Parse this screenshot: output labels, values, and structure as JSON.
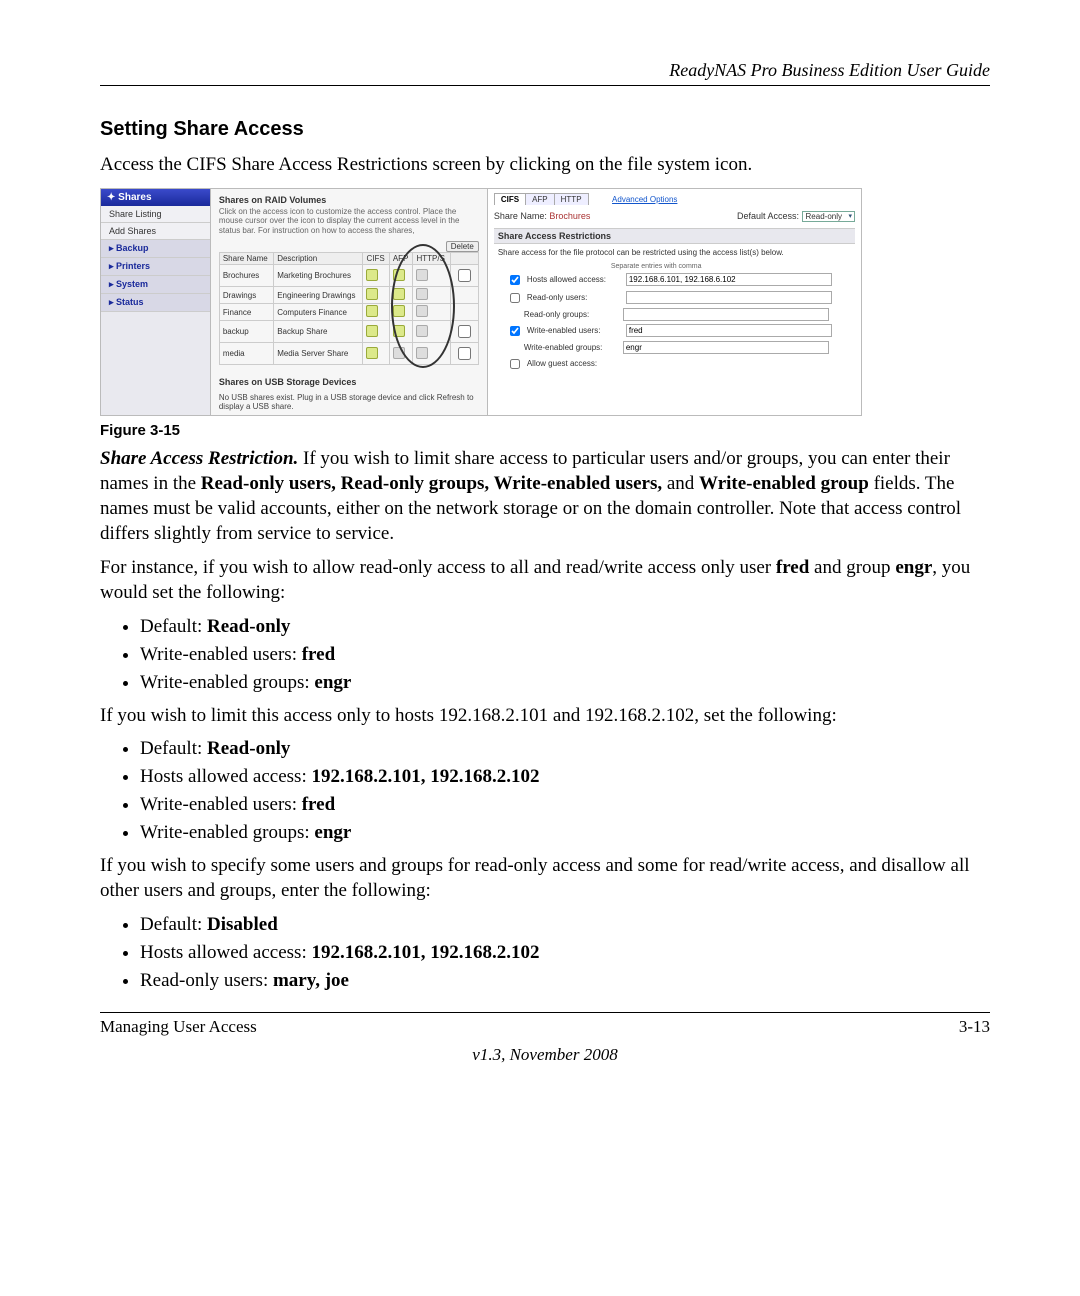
{
  "header": {
    "title": "ReadyNAS Pro Business Edition User Guide"
  },
  "section": {
    "title": "Setting Share Access"
  },
  "intro": "Access the CIFS Share Access Restrictions screen by clicking on the file system icon.",
  "figure_caption": "Figure 3-15",
  "mock": {
    "sidebar": {
      "head": "Shares",
      "items": [
        "Share Listing",
        "Add Shares",
        "Backup",
        "Printers",
        "System",
        "Status"
      ]
    },
    "shares_panel_title": "Shares on RAID Volumes",
    "shares_hint": "Click on the access icon to customize the access control. Place the mouse cursor over the icon to display the current access level in the status bar. For instruction on how to access the shares,",
    "columns": [
      "Share Name",
      "Description",
      "CIFS",
      "AFP",
      "HTTP/S",
      ""
    ],
    "delete_btn": "Delete",
    "rows": [
      {
        "name": "Brochures",
        "desc": "Marketing Brochures"
      },
      {
        "name": "Drawings",
        "desc": "Engineering Drawings"
      },
      {
        "name": "Finance",
        "desc": "Computers Finance"
      },
      {
        "name": "backup",
        "desc": "Backup Share"
      },
      {
        "name": "media",
        "desc": "Media Server Share"
      }
    ],
    "usb_title": "Shares on USB Storage Devices",
    "usb_note": "No USB shares exist. Plug in a USB storage device and click Refresh to display a USB share.",
    "right": {
      "tabs": [
        "CIFS",
        "AFP",
        "HTTP"
      ],
      "adv": "Advanced Options",
      "share_name_label": "Share Name:",
      "share_name": "Brochures",
      "default_access_label": "Default Access:",
      "default_access": "Read-only",
      "restrict_head": "Share Access Restrictions",
      "restrict_note": "Share access for the file protocol can be restricted using the access list(s) below.",
      "sep": "Separate entries with comma",
      "fields": {
        "hosts_lbl": "Hosts allowed access:",
        "hosts_val": "192.168.6.101, 192.168.6.102",
        "ro_users_lbl": "Read-only users:",
        "ro_groups_lbl": "Read-only groups:",
        "we_users_lbl": "Write-enabled users:",
        "we_users_val": "fred",
        "we_groups_lbl": "Write-enabled groups:",
        "we_groups_val": "engr",
        "guest_lbl": "Allow guest access:"
      }
    }
  },
  "para_restriction_lead": "Share Access Restriction.",
  "para_restriction_body1": " If you wish to limit share access to particular users and/or groups, you can enter their names in the ",
  "para_restriction_bold_fields": "Read-only users, Read-only groups, Write-enabled users,",
  "para_restriction_body2": " and ",
  "para_restriction_bold_group": "Write-enabled group",
  "para_restriction_body3": " fields. The names must be valid accounts, either on the network storage or on the domain controller. Note that access control differs slightly from service to service.",
  "para_example1a": "For instance, if you wish to allow read-only access to all and read/write access only user ",
  "para_example1_fred": "fred",
  "para_example1b": " and group ",
  "para_example1_engr": "engr",
  "para_example1c": ", you would set the following:",
  "list1": [
    {
      "pre": "Default: ",
      "bold": "Read-only"
    },
    {
      "pre": "Write-enabled users: ",
      "bold": "fred"
    },
    {
      "pre": "Write-enabled groups: ",
      "bold": "engr"
    }
  ],
  "para_hosts": "If you wish to limit this access only to hosts 192.168.2.101 and 192.168.2.102, set the following:",
  "list2": [
    {
      "pre": "Default: ",
      "bold": "Read-only"
    },
    {
      "pre": "Hosts allowed access: ",
      "bold": "192.168.2.101, 192.168.2.102"
    },
    {
      "pre": "Write-enabled users: ",
      "bold": "fred"
    },
    {
      "pre": "Write-enabled groups: ",
      "bold": "engr"
    }
  ],
  "para_disallow": "If you wish to specify some users and groups for read-only access and some for read/write access, and disallow all other users and groups, enter the following:",
  "list3": [
    {
      "pre": "Default: ",
      "bold": "Disabled"
    },
    {
      "pre": "Hosts allowed access: ",
      "bold": "192.168.2.101, 192.168.2.102"
    },
    {
      "pre": "Read-only users: ",
      "bold": "mary, joe"
    }
  ],
  "footer": {
    "left": "Managing User Access",
    "right": "3-13",
    "version": "v1.3, November 2008"
  }
}
